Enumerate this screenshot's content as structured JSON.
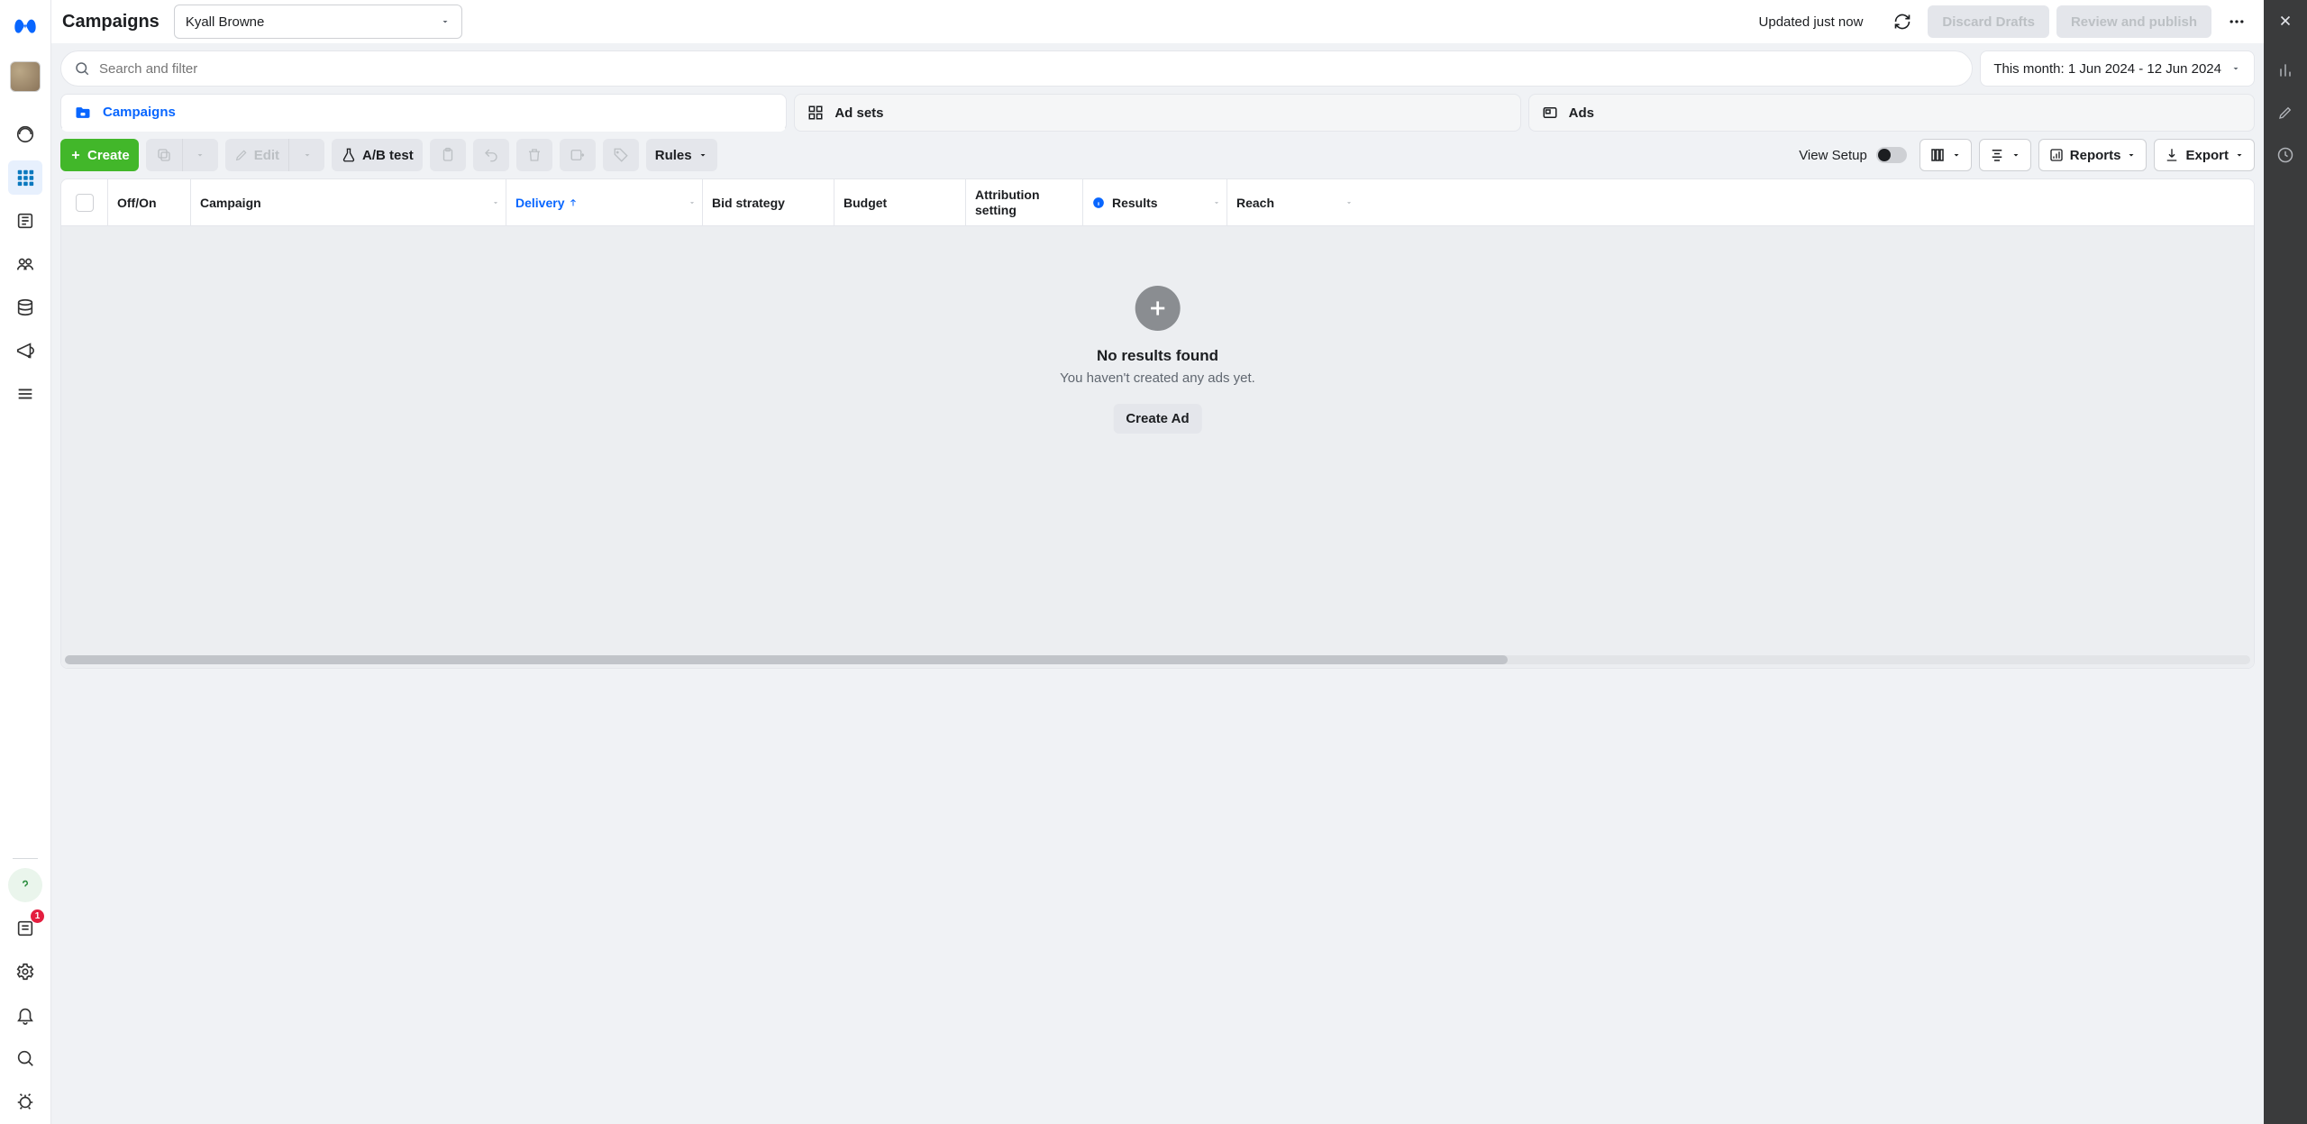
{
  "header": {
    "page_title": "Campaigns",
    "account_name": "Kyall Browne",
    "updated_text": "Updated just now",
    "discard_label": "Discard Drafts",
    "review_label": "Review and publish"
  },
  "search": {
    "placeholder": "Search and filter",
    "date_label": "This month: 1 Jun 2024 - 12 Jun 2024"
  },
  "tabs": {
    "campaigns": "Campaigns",
    "adsets": "Ad sets",
    "ads": "Ads"
  },
  "toolbar": {
    "create": "Create",
    "edit": "Edit",
    "abtest": "A/B test",
    "rules": "Rules",
    "view_setup": "View Setup",
    "reports": "Reports",
    "export": "Export"
  },
  "columns": {
    "onoff": "Off/On",
    "campaign": "Campaign",
    "delivery": "Delivery",
    "bid": "Bid strategy",
    "budget": "Budget",
    "attribution": "Attribution setting",
    "results": "Results",
    "reach": "Reach"
  },
  "empty": {
    "title": "No results found",
    "subtitle": "You haven't created any ads yet.",
    "cta": "Create Ad"
  },
  "rail_badge": "1"
}
